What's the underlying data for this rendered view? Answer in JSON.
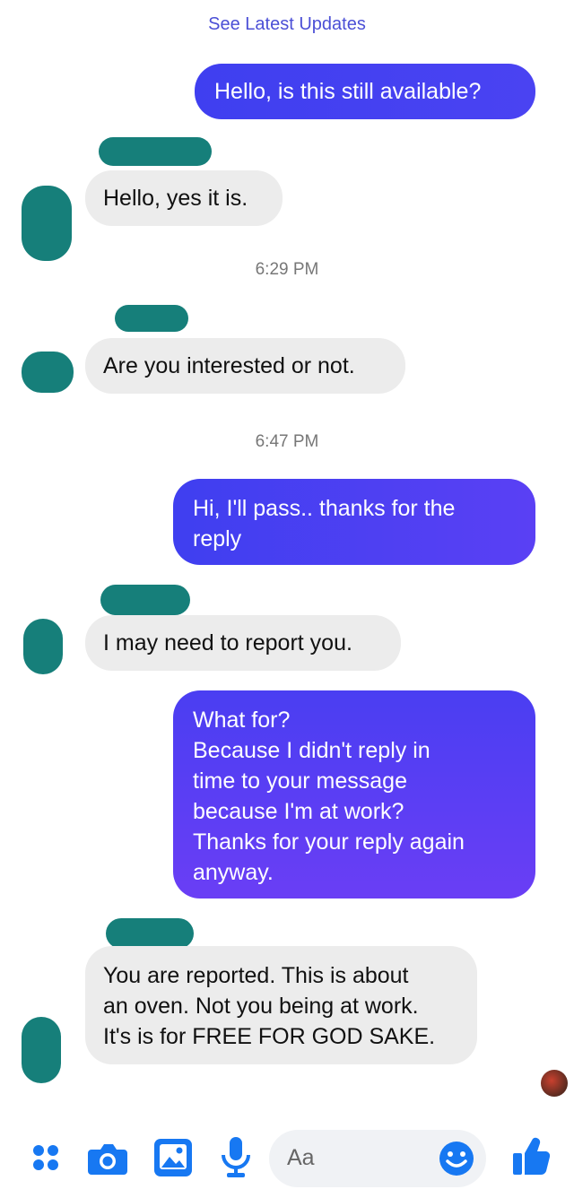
{
  "header": {
    "see_latest": "See Latest Updates"
  },
  "messages": [
    {
      "text": "Hello, is this still available?"
    },
    {
      "text": "Hello, yes it is."
    },
    {
      "time": "6:29 PM"
    },
    {
      "text": "Are you interested or not."
    },
    {
      "time": "6:47 PM"
    },
    {
      "lines": [
        "Hi, I'll pass.. thanks for the",
        "reply"
      ]
    },
    {
      "text": "I may need to report you."
    },
    {
      "lines": [
        "What for?",
        "Because I didn't  reply in",
        "time to your message",
        "because I'm at work?",
        "Thanks for your reply again",
        "anyway."
      ]
    },
    {
      "lines": [
        "You are reported. This is about",
        "an oven. Not you being at work.",
        "It's is for FREE FOR GOD SAKE."
      ]
    }
  ],
  "composer": {
    "placeholder": "Aa",
    "icons": [
      "menu-dots-icon",
      "camera-icon",
      "gallery-icon",
      "microphone-icon",
      "emoji-icon",
      "thumbs-up-icon"
    ]
  },
  "colors": {
    "outgoing_start": "#3f3ff0",
    "outgoing_end": "#6a3ef5",
    "incoming": "#ececec",
    "accent": "#1778f2",
    "scribble": "#167f7a"
  }
}
